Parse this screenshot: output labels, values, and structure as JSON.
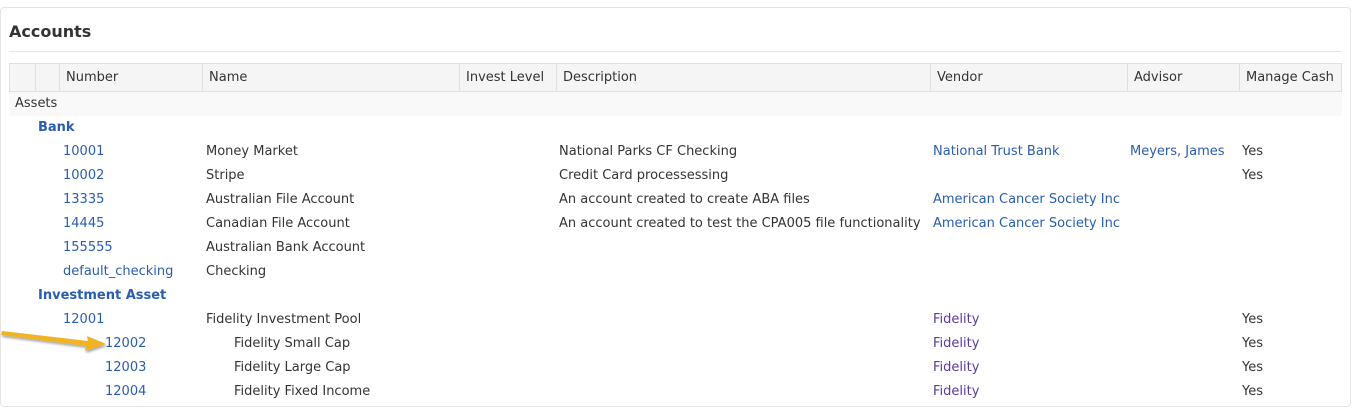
{
  "title": "Accounts",
  "columns": {
    "number": "Number",
    "name": "Name",
    "invest_level": "Invest Level",
    "description": "Description",
    "vendor": "Vendor",
    "advisor": "Advisor",
    "manage_cash": "Manage Cash"
  },
  "group": "Assets",
  "categories": [
    {
      "label": "Bank",
      "rows": [
        {
          "number": "10001",
          "name": "Money Market",
          "description": "National Parks CF Checking",
          "vendor": "National Trust Bank",
          "advisor": "Meyers, James",
          "manage_cash": "Yes"
        },
        {
          "number": "10002",
          "name": "Stripe",
          "description": "Credit Card processessing",
          "vendor": "",
          "advisor": "",
          "manage_cash": "Yes"
        },
        {
          "number": "13335",
          "name": "Australian File Account",
          "description": "An account created to create ABA files",
          "vendor": "American Cancer Society Inc",
          "advisor": "",
          "manage_cash": ""
        },
        {
          "number": "14445",
          "name": "Canadian File Account",
          "description": "An account created to test the CPA005 file functionality",
          "vendor": "American Cancer Society Inc",
          "advisor": "",
          "manage_cash": ""
        },
        {
          "number": "155555",
          "name": "Australian Bank Account",
          "description": "",
          "vendor": "",
          "advisor": "",
          "manage_cash": ""
        },
        {
          "number": "default_checking",
          "name": "Checking",
          "description": "",
          "vendor": "",
          "advisor": "",
          "manage_cash": ""
        }
      ]
    },
    {
      "label": "Investment Asset",
      "rows": [
        {
          "number": "12001",
          "name": "Fidelity Investment Pool",
          "description": "",
          "vendor": "Fidelity",
          "advisor": "",
          "manage_cash": "Yes",
          "child": false
        },
        {
          "number": "12002",
          "name": "Fidelity Small Cap",
          "description": "",
          "vendor": "Fidelity",
          "advisor": "",
          "manage_cash": "Yes",
          "child": true
        },
        {
          "number": "12003",
          "name": "Fidelity Large Cap",
          "description": "",
          "vendor": "Fidelity",
          "advisor": "",
          "manage_cash": "Yes",
          "child": true
        },
        {
          "number": "12004",
          "name": "Fidelity Fixed Income",
          "description": "",
          "vendor": "Fidelity",
          "advisor": "",
          "manage_cash": "Yes",
          "child": true
        }
      ]
    }
  ],
  "colors": {
    "link": "#2a5db0",
    "vendor_visited": "#5b3aa0",
    "arrow": "#f0b323"
  },
  "annotation_icon": "arrow-pointer-icon"
}
